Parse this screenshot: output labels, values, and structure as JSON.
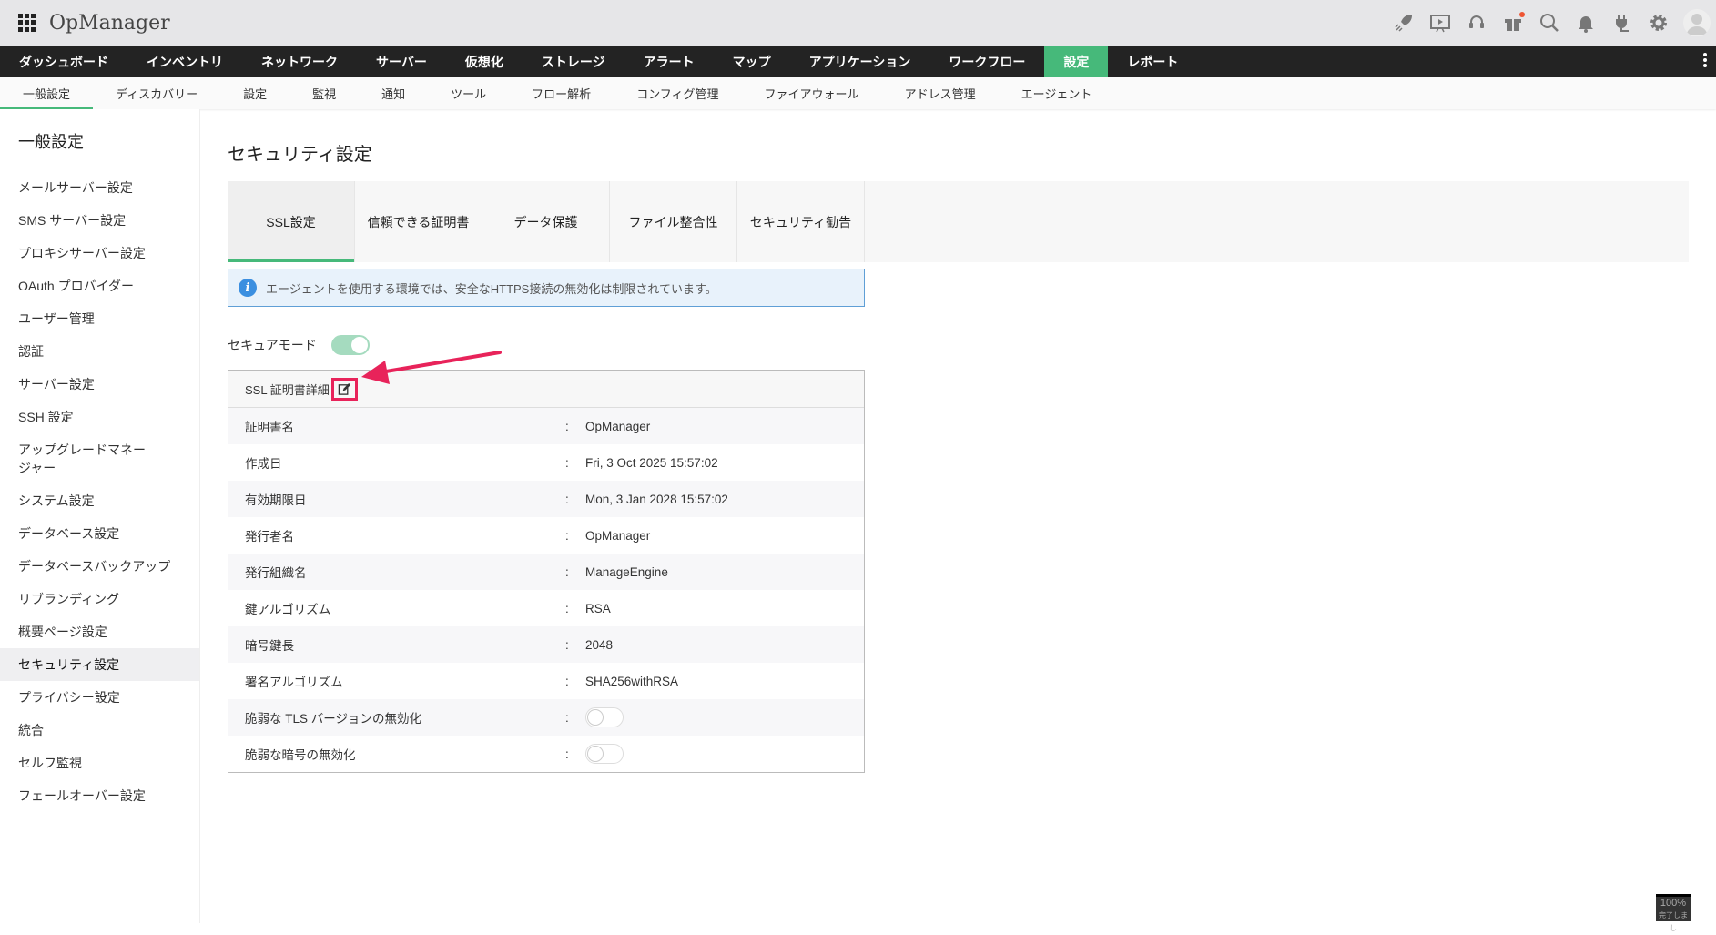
{
  "app": {
    "title": "OpMenager_label_placeholder"
  },
  "header": {
    "brand": "OpManager",
    "icons": [
      "rocket-icon",
      "presentation-icon",
      "headset-icon",
      "gift-icon",
      "search-icon",
      "bell-icon",
      "plug-icon",
      "gear-icon",
      "avatar-icon"
    ]
  },
  "main_nav": [
    {
      "label": "ダッシュボード"
    },
    {
      "label": "インベントリ"
    },
    {
      "label": "ネットワーク"
    },
    {
      "label": "サーバー"
    },
    {
      "label": "仮想化"
    },
    {
      "label": "ストレージ"
    },
    {
      "label": "アラート"
    },
    {
      "label": "マップ"
    },
    {
      "label": "アプリケーション"
    },
    {
      "label": "ワークフロー"
    },
    {
      "label": "設定",
      "active": true
    },
    {
      "label": "レポート"
    }
  ],
  "sub_nav": [
    {
      "label": "一般設定",
      "active": true
    },
    {
      "label": "ディスカバリー"
    },
    {
      "label": "設定"
    },
    {
      "label": "監視"
    },
    {
      "label": "通知"
    },
    {
      "label": "ツール"
    },
    {
      "label": "フロー解析"
    },
    {
      "label": "コンフィグ管理"
    },
    {
      "label": "ファイアウォール"
    },
    {
      "label": "アドレス管理"
    },
    {
      "label": "エージェント"
    }
  ],
  "sidebar": {
    "title": "一般設定",
    "items": [
      {
        "label": "メールサーバー設定"
      },
      {
        "label": "SMS サーバー設定"
      },
      {
        "label": "プロキシサーバー設定"
      },
      {
        "label": "OAuth プロバイダー"
      },
      {
        "label": "ユーザー管理"
      },
      {
        "label": "認証"
      },
      {
        "label": "サーバー設定"
      },
      {
        "label": "SSH 設定"
      },
      {
        "label": "アップグレードマネージャー"
      },
      {
        "label": "システム設定"
      },
      {
        "label": "データベース設定"
      },
      {
        "label": "データベースバックアップ"
      },
      {
        "label": "リブランディング"
      },
      {
        "label": "概要ページ設定"
      },
      {
        "label": "セキュリティ設定",
        "active": true
      },
      {
        "label": "プライバシー設定"
      },
      {
        "label": "統合"
      },
      {
        "label": "セルフ監視"
      },
      {
        "label": "フェールオーバー設定"
      }
    ]
  },
  "page": {
    "title": "セキュリティ設定",
    "tabs": [
      {
        "label": "SSL設定",
        "active": true
      },
      {
        "label": "信頼できる証明書"
      },
      {
        "label": "データ保護"
      },
      {
        "label": "ファイル整合性"
      },
      {
        "label": "セキュリティ勧告"
      }
    ],
    "info": "エージェントを使用する環境では、安全なHTTPS接続の無効化は制限されています。",
    "secure_mode": {
      "label": "セキュアモード",
      "on": true
    },
    "card": {
      "title": "SSL 証明書詳細",
      "rows": [
        {
          "key": "証明書名",
          "value": "OpManager"
        },
        {
          "key": "作成日",
          "value": "Fri, 3 Oct 2025 15:57:02"
        },
        {
          "key": "有効期限日",
          "value": "Mon, 3 Jan 2028 15:57:02"
        },
        {
          "key": "発行者名",
          "value": "OpManager"
        },
        {
          "key": "発行組織名",
          "value": "ManageEngine"
        },
        {
          "key": "鍵アルゴリズム",
          "value": "RSA"
        },
        {
          "key": "暗号鍵長",
          "value": "2048"
        },
        {
          "key": "署名アルゴリズム",
          "value": "SHA256withRSA"
        }
      ],
      "toggles": [
        {
          "key": "脆弱な TLS バージョンの無効化",
          "on": false
        },
        {
          "key": "脆弱な暗号の無効化",
          "on": false
        }
      ],
      "separator": ":"
    }
  },
  "zoom_indicator": {
    "value": "100%",
    "text": "完了しまし"
  },
  "colors": {
    "accent": "#46b97a",
    "annotation": "#e8235a",
    "nav_bg": "#232323"
  }
}
